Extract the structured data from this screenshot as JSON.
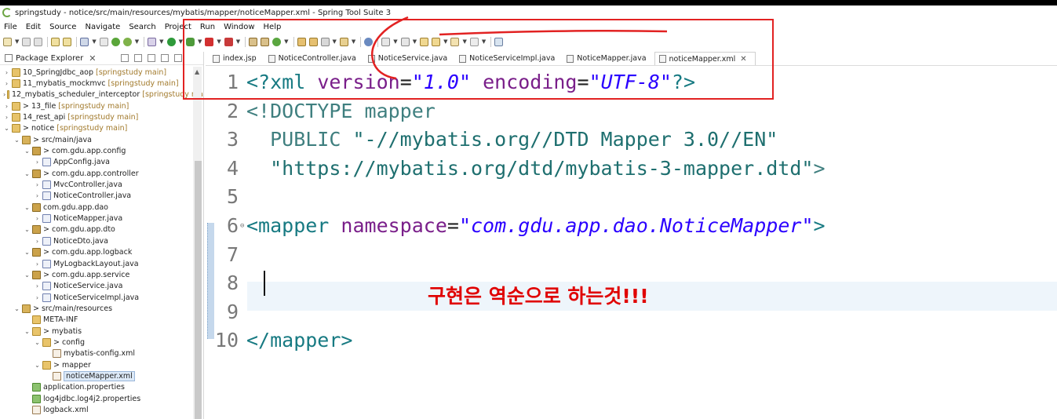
{
  "window": {
    "title": "springstudy - notice/src/main/resources/mybatis/mapper/noticeMapper.xml - Spring Tool Suite 3"
  },
  "menu": [
    "File",
    "Edit",
    "Source",
    "Navigate",
    "Search",
    "Project",
    "Run",
    "Window",
    "Help"
  ],
  "package_explorer": {
    "title": "Package Explorer",
    "close": "✕",
    "tree": [
      {
        "label": "10_SpringJdbc_aop",
        "meta": "[springstudy main]",
        "icon": "project-icon",
        "twisty": "›"
      },
      {
        "label": "11_mybatis_mockmvc",
        "meta": "[springstudy main]",
        "icon": "project-icon",
        "twisty": "›"
      },
      {
        "label": "12_mybatis_scheduler_interceptor",
        "meta": "[springstudy ma",
        "icon": "project-icon",
        "twisty": "›"
      },
      {
        "label": "> 13_file",
        "meta": "[springstudy main]",
        "icon": "project-icon",
        "twisty": "›"
      },
      {
        "label": "14_rest_api",
        "meta": "[springstudy main]",
        "icon": "project-icon",
        "twisty": "›"
      },
      {
        "label": "> notice",
        "meta": "[springstudy main]",
        "icon": "project-icon",
        "twisty": "⌄"
      },
      {
        "label": "> src/main/java",
        "meta": "",
        "icon": "source-folder-icon",
        "twisty": "⌄"
      },
      {
        "label": "> com.gdu.app.config",
        "meta": "",
        "icon": "package-icon",
        "twisty": "⌄"
      },
      {
        "label": "AppConfig.java",
        "meta": "",
        "icon": "java-file-icon",
        "twisty": "›"
      },
      {
        "label": "> com.gdu.app.controller",
        "meta": "",
        "icon": "package-icon",
        "twisty": "⌄"
      },
      {
        "label": "MvcController.java",
        "meta": "",
        "icon": "java-file-icon",
        "twisty": "›"
      },
      {
        "label": "NoticeController.java",
        "meta": "",
        "icon": "java-file-icon",
        "twisty": "›"
      },
      {
        "label": "com.gdu.app.dao",
        "meta": "",
        "icon": "package-icon",
        "twisty": "⌄"
      },
      {
        "label": "NoticeMapper.java",
        "meta": "",
        "icon": "java-file-icon",
        "twisty": "›"
      },
      {
        "label": "> com.gdu.app.dto",
        "meta": "",
        "icon": "package-icon",
        "twisty": "⌄"
      },
      {
        "label": "NoticeDto.java",
        "meta": "",
        "icon": "java-file-icon",
        "twisty": "›"
      },
      {
        "label": "> com.gdu.app.logback",
        "meta": "",
        "icon": "package-icon",
        "twisty": "⌄"
      },
      {
        "label": "MyLogbackLayout.java",
        "meta": "",
        "icon": "java-file-icon",
        "twisty": "›"
      },
      {
        "label": "> com.gdu.app.service",
        "meta": "",
        "icon": "package-icon",
        "twisty": "⌄"
      },
      {
        "label": "NoticeService.java",
        "meta": "",
        "icon": "java-file-icon",
        "twisty": "›"
      },
      {
        "label": "NoticeServiceImpl.java",
        "meta": "",
        "icon": "java-file-icon",
        "twisty": "›"
      },
      {
        "label": "> src/main/resources",
        "meta": "",
        "icon": "source-folder-icon",
        "twisty": "⌄"
      },
      {
        "label": "META-INF",
        "meta": "",
        "icon": "folder-icon",
        "twisty": ""
      },
      {
        "label": "> mybatis",
        "meta": "",
        "icon": "folder-icon",
        "twisty": "⌄"
      },
      {
        "label": "> config",
        "meta": "",
        "icon": "folder-icon",
        "twisty": "⌄"
      },
      {
        "label": "mybatis-config.xml",
        "meta": "",
        "icon": "xml-file-icon",
        "twisty": ""
      },
      {
        "label": "> mapper",
        "meta": "",
        "icon": "folder-icon",
        "twisty": "⌄"
      },
      {
        "label": "noticeMapper.xml",
        "meta": "",
        "icon": "xml-file-icon",
        "twisty": "",
        "selected": true
      },
      {
        "label": "application.properties",
        "meta": "",
        "icon": "properties-file-icon",
        "twisty": ""
      },
      {
        "label": "log4jdbc.log4j2.properties",
        "meta": "",
        "icon": "properties-file-icon",
        "twisty": ""
      },
      {
        "label": "logback.xml",
        "meta": "",
        "icon": "xml-file-icon",
        "twisty": ""
      }
    ]
  },
  "editor_tabs": [
    {
      "label": "index.jsp",
      "active": false
    },
    {
      "label": "NoticeController.java",
      "active": false
    },
    {
      "label": "NoticeService.java",
      "active": false
    },
    {
      "label": "NoticeServiceImpl.java",
      "active": false
    },
    {
      "label": "NoticeMapper.java",
      "active": false
    },
    {
      "label": "noticeMapper.xml",
      "active": true
    }
  ],
  "tab_close": "✕",
  "code_lines": [
    {
      "n": "1",
      "fold": "",
      "tokens": [
        [
          "c-tag",
          "<?"
        ],
        [
          "c-tag",
          "xml"
        ],
        [
          "c-plain",
          " "
        ],
        [
          "c-attr",
          "version"
        ],
        [
          "c-plain",
          "="
        ],
        [
          "c-str",
          "\"1.0\""
        ],
        [
          "c-plain",
          " "
        ],
        [
          "c-attr",
          "encoding"
        ],
        [
          "c-plain",
          "="
        ],
        [
          "c-str",
          "\"UTF-8\""
        ],
        [
          "c-tag",
          "?>"
        ]
      ]
    },
    {
      "n": "2",
      "fold": "",
      "tokens": [
        [
          "c-dt",
          "<!DOCTYPE mapper"
        ]
      ]
    },
    {
      "n": "3",
      "fold": "",
      "tokens": [
        [
          "c-dt",
          "  PUBLIC "
        ],
        [
          "c-dtstr",
          "\"-//mybatis.org//DTD Mapper 3.0//EN\""
        ]
      ]
    },
    {
      "n": "4",
      "fold": "",
      "tokens": [
        [
          "c-dtstr",
          "  \"https://mybatis.org/dtd/mybatis-3-mapper.dtd\""
        ],
        [
          "c-dt",
          ">"
        ]
      ]
    },
    {
      "n": "5",
      "fold": "",
      "tokens": []
    },
    {
      "n": "6",
      "fold": "⊖",
      "tokens": [
        [
          "c-tag",
          "<mapper"
        ],
        [
          "c-plain",
          " "
        ],
        [
          "c-attr",
          "namespace"
        ],
        [
          "c-plain",
          "="
        ],
        [
          "c-str",
          "\"com.gdu.app.dao.NoticeMapper\""
        ],
        [
          "c-tag",
          ">"
        ]
      ]
    },
    {
      "n": "7",
      "fold": "",
      "tokens": []
    },
    {
      "n": "8",
      "fold": "",
      "tokens": [],
      "caret": true
    },
    {
      "n": "9",
      "fold": "",
      "tokens": []
    },
    {
      "n": "10",
      "fold": "",
      "tokens": [
        [
          "c-tag",
          "</mapper>"
        ]
      ]
    }
  ],
  "annotation_text": "구현은 역순으로 하는것!!!",
  "colors": {
    "annotation": "#e00000",
    "tag": "#177a82",
    "attr": "#7a1f8a",
    "string": "#2a00ff"
  }
}
